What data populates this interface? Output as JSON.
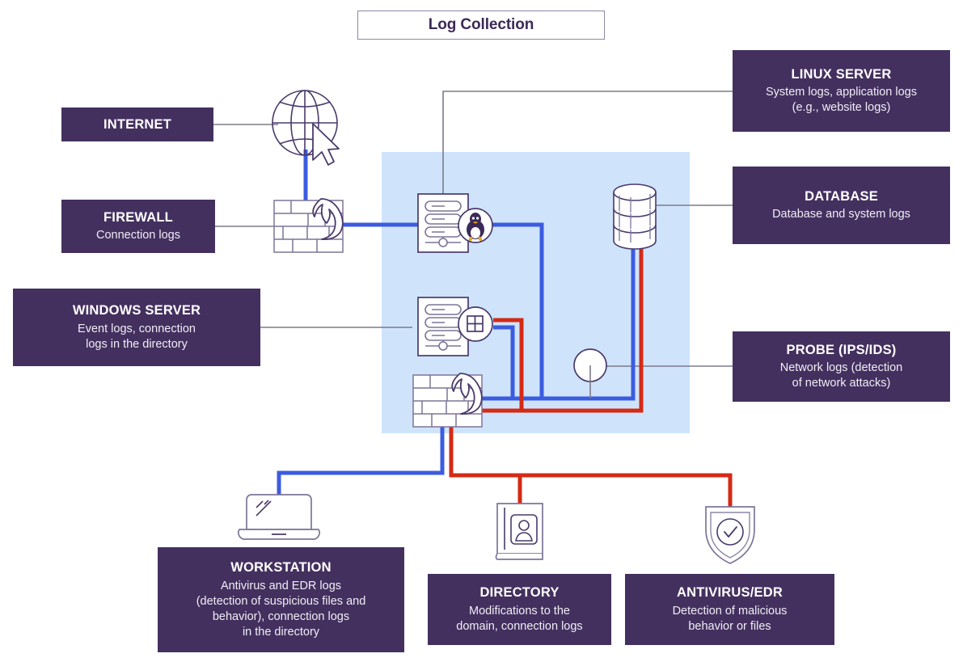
{
  "title": {
    "text": "Log Collection"
  },
  "colors": {
    "purple": "#44305f",
    "panel_blue": "#cfe4fb",
    "line_blue": "#3b5ce0",
    "line_red": "#d42a16",
    "line_grey": "#7d7a8c",
    "icon_stroke": "#4a3a6b"
  },
  "boxes": {
    "internet": {
      "title": "INTERNET",
      "subtitle": ""
    },
    "firewall": {
      "title": "FIREWALL",
      "subtitle": "Connection logs"
    },
    "windows_server": {
      "title": "WINDOWS SERVER",
      "subtitle": "Event logs, connection\nlogs in the directory"
    },
    "linux_server": {
      "title": "LINUX SERVER",
      "subtitle": "System logs, application logs\n(e.g., website logs)"
    },
    "database": {
      "title": "DATABASE",
      "subtitle": "Database and system logs"
    },
    "probe": {
      "title": "PROBE (IPS/IDS)",
      "subtitle": "Network logs (detection\nof network attacks)"
    },
    "workstation": {
      "title": "WORKSTATION",
      "subtitle": "Antivirus and EDR logs\n(detection of suspicious files and\nbehavior), connection logs\nin the directory"
    },
    "directory": {
      "title": "DIRECTORY",
      "subtitle": "Modifications to the\ndomain, connection logs"
    },
    "antivirus_edr": {
      "title": "ANTIVIRUS/EDR",
      "subtitle": "Detection of malicious\nbehavior or files"
    }
  },
  "icons": {
    "globe": "globe-cursor-icon",
    "firewall_outer": "firewall-brick-flame-icon",
    "linux_server": "server-linux-icon",
    "windows_server": "server-windows-icon",
    "firewall_inner": "firewall-brick-flame-icon",
    "database": "database-cylinder-icon",
    "probe": "probe-circle-icon",
    "workstation": "laptop-icon",
    "directory": "directory-book-icon",
    "antivirus": "shield-check-icon"
  }
}
